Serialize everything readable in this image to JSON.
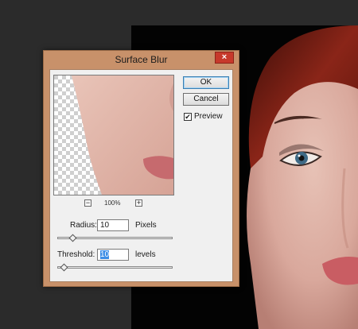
{
  "dialog": {
    "title": "Surface Blur",
    "close_symbol": "×",
    "ok_label": "OK",
    "cancel_label": "Cancel",
    "preview": {
      "label": "Preview",
      "checked": true,
      "check_mark": "✔"
    },
    "zoom": {
      "minus": "−",
      "plus": "+",
      "level": "100%"
    },
    "radius": {
      "label": "Radius:",
      "value": "10",
      "unit": "Pixels",
      "slider_fraction": 0.1
    },
    "threshold": {
      "label": "Threshold:",
      "value": "10",
      "unit": "levels",
      "slider_fraction": 0.02
    }
  },
  "colors": {
    "dialog_frame": "#c8916a",
    "close_button": "#c7392b",
    "canvas_background": "#030303",
    "workspace_background": "#2b2b2b",
    "selection": "#3d8ee6"
  }
}
